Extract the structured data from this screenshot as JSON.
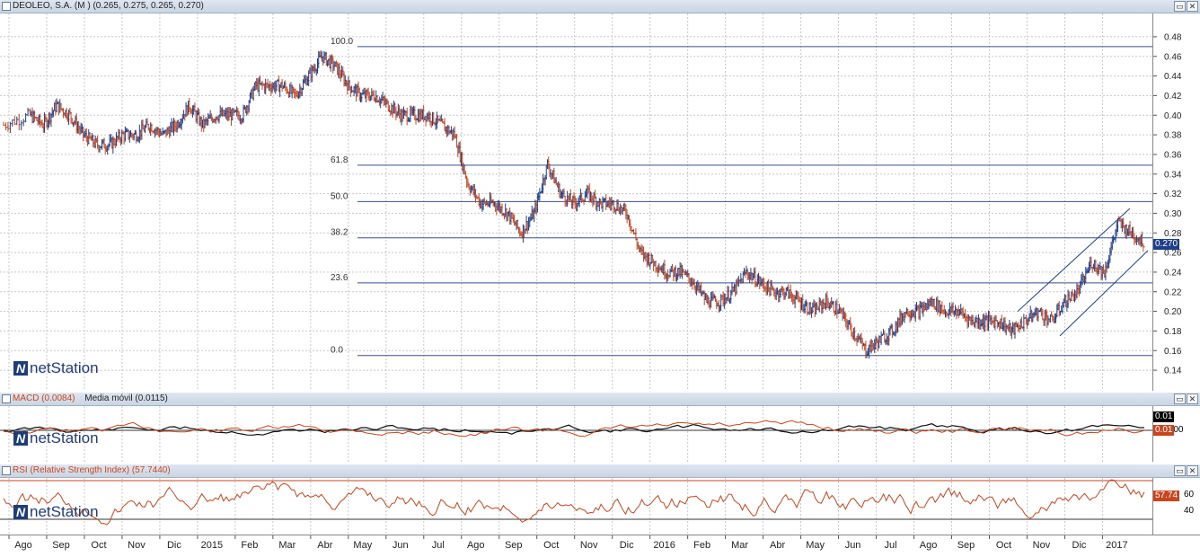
{
  "panels": {
    "price": {
      "title": "DEOLEO, S.A. (M ) (0.265, 0.275, 0.265, 0.270)",
      "last_label": "0.270",
      "last_color": "#1d3f8a"
    },
    "macd": {
      "title": "MACD (0.0084)",
      "title2": "Media móvil (0.0115)",
      "tag1": "0.01",
      "tag2": "0.01",
      "zero_label": "0.00",
      "colors": {
        "macd": "#c8461e",
        "signal": "#111111"
      }
    },
    "rsi": {
      "title": "RSI (Relative Strength Index) (57.7440)",
      "tag": "57.74",
      "tick_60": "60",
      "tick_40": "40",
      "color": "#c8461e"
    }
  },
  "logo_text": "netStation",
  "logo_mark": "N",
  "buttons": {
    "minimize": "▭",
    "close": "✕"
  },
  "chart_data": {
    "type": "line",
    "title": "DEOLEO, S.A. (M ) (0.265, 0.275, 0.265, 0.270)",
    "ylim": [
      0.13,
      0.49
    ],
    "y_ticks": [
      "0.48",
      "0.46",
      "0.44",
      "0.42",
      "0.40",
      "0.38",
      "0.36",
      "0.34",
      "0.32",
      "0.30",
      "0.28",
      "0.26",
      "0.24",
      "0.22",
      "0.20",
      "0.18",
      "0.16",
      "0.14"
    ],
    "x_tick_labels": [
      "Ago",
      "Sep",
      "Oct",
      "Nov",
      "Dic",
      "2015",
      "Feb",
      "Mar",
      "Abr",
      "May",
      "Jun",
      "Jul",
      "Ago",
      "Sep",
      "Oct",
      "Nov",
      "Dic",
      "2016",
      "Feb",
      "Mar",
      "Abr",
      "May",
      "Jun",
      "Jul",
      "Ago",
      "Sep",
      "Oct",
      "Nov",
      "Dic",
      "2017"
    ],
    "fibonacci_levels": [
      {
        "label": "100.0",
        "price": 0.47
      },
      {
        "label": "61.8",
        "price": 0.349
      },
      {
        "label": "50.0",
        "price": 0.312
      },
      {
        "label": "38.2",
        "price": 0.275
      },
      {
        "label": "23.6",
        "price": 0.229
      },
      {
        "label": "0.0",
        "price": 0.155
      }
    ],
    "series": [
      {
        "points": [
          [
            0,
            0.39
          ],
          [
            2,
            0.4
          ],
          [
            3,
            0.39
          ],
          [
            4,
            0.41
          ],
          [
            5,
            0.4
          ],
          [
            6,
            0.38
          ],
          [
            7,
            0.37
          ],
          [
            8,
            0.37
          ],
          [
            9,
            0.38
          ],
          [
            10,
            0.38
          ],
          [
            11,
            0.39
          ],
          [
            12,
            0.38
          ],
          [
            13,
            0.39
          ],
          [
            14,
            0.41
          ],
          [
            15,
            0.39
          ],
          [
            16,
            0.4
          ],
          [
            17,
            0.4
          ],
          [
            18,
            0.4
          ],
          [
            19,
            0.43
          ],
          [
            20,
            0.43
          ],
          [
            21,
            0.43
          ],
          [
            22,
            0.42
          ],
          [
            23,
            0.44
          ],
          [
            24,
            0.46
          ],
          [
            25,
            0.45
          ],
          [
            26,
            0.43
          ],
          [
            27,
            0.42
          ],
          [
            28,
            0.42
          ],
          [
            29,
            0.41
          ],
          [
            30,
            0.4
          ],
          [
            31,
            0.4
          ],
          [
            32,
            0.4
          ],
          [
            33,
            0.39
          ],
          [
            34,
            0.38
          ],
          [
            35,
            0.33
          ],
          [
            36,
            0.31
          ],
          [
            37,
            0.31
          ],
          [
            38,
            0.3
          ],
          [
            39,
            0.28
          ],
          [
            40,
            0.3
          ],
          [
            41,
            0.35
          ],
          [
            42,
            0.32
          ],
          [
            43,
            0.31
          ],
          [
            44,
            0.32
          ],
          [
            45,
            0.31
          ],
          [
            46,
            0.31
          ],
          [
            47,
            0.3
          ],
          [
            48,
            0.26
          ],
          [
            49,
            0.25
          ],
          [
            50,
            0.24
          ],
          [
            51,
            0.24
          ],
          [
            52,
            0.23
          ],
          [
            53,
            0.21
          ],
          [
            54,
            0.21
          ],
          [
            55,
            0.22
          ],
          [
            56,
            0.24
          ],
          [
            57,
            0.23
          ],
          [
            58,
            0.22
          ],
          [
            59,
            0.22
          ],
          [
            60,
            0.21
          ],
          [
            61,
            0.2
          ],
          [
            62,
            0.21
          ],
          [
            63,
            0.2
          ],
          [
            64,
            0.18
          ],
          [
            65,
            0.16
          ],
          [
            66,
            0.17
          ],
          [
            67,
            0.18
          ],
          [
            68,
            0.2
          ],
          [
            69,
            0.2
          ],
          [
            70,
            0.21
          ],
          [
            71,
            0.2
          ],
          [
            72,
            0.2
          ],
          [
            73,
            0.19
          ],
          [
            74,
            0.19
          ],
          [
            75,
            0.19
          ],
          [
            76,
            0.18
          ],
          [
            77,
            0.19
          ],
          [
            78,
            0.2
          ],
          [
            79,
            0.19
          ],
          [
            80,
            0.21
          ],
          [
            81,
            0.22
          ],
          [
            82,
            0.25
          ],
          [
            83,
            0.24
          ],
          [
            84,
            0.29
          ],
          [
            85,
            0.28
          ],
          [
            86,
            0.27
          ]
        ]
      }
    ]
  }
}
